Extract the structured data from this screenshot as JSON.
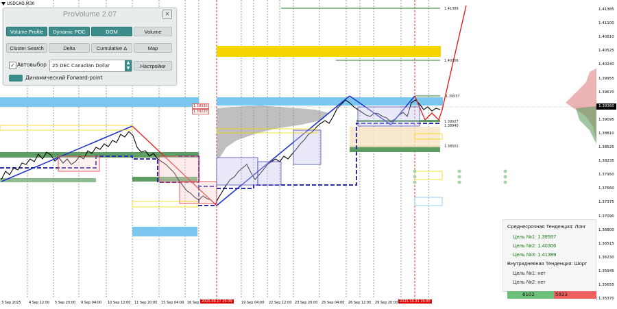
{
  "symbol": "USDCAD,M30",
  "panel": {
    "title": "ProVolume 2.07",
    "close": "×",
    "buttons_row1": [
      "Volume Profile",
      "Dynamic POC",
      "DOM",
      "Volume"
    ],
    "buttons_row2": [
      "Cluster Search",
      "Delta",
      "Cumulative Δ",
      "Map"
    ],
    "auto_label": "Автовыбор",
    "auto_checked": "✓",
    "instrument": "25 DEC Canadian Dollar",
    "settings_button": "Настройки",
    "forward_label": "Динамический Forward-point"
  },
  "y_axis": [
    "1.41385",
    "1.41100",
    "1.40810",
    "1.40525",
    "1.40240",
    "1.39955",
    "1.39670",
    "1.39380",
    "1.39095",
    "1.38810",
    "1.38525",
    "1.38235",
    "1.37950",
    "1.37660",
    "1.37375",
    "1.37090",
    "1.36800",
    "1.36515",
    "1.36230",
    "1.35945",
    "1.35655",
    "1.35370"
  ],
  "current_price": "1.39360",
  "x_axis": [
    "3 Sep 2025",
    "4 Sep 12:00",
    "5 Sep 20:00",
    "9 Sep 04:00",
    "10 Sep 12:00",
    "11 Sep 20:00",
    "15 Sep 04:00",
    "16 Sep",
    "19 Sep 04:00",
    "22 Sep 12:00",
    "23 Sep 20:00",
    "25 Sep 04:00",
    "26 Sep 12:00",
    "29 Sep 20:00"
  ],
  "x_highlight_1": "2025.09.17 20:30",
  "x_highlight_2": "2025.10.01 19:00",
  "levels": {
    "l1": "1.41389",
    "l2": "1.40306",
    "l3": "1.39557",
    "l4": "1.39027",
    "l5": "1.38940",
    "l6": "1.38501",
    "r1": "1.39330",
    "r2": "1.39220"
  },
  "info": {
    "mid_trend": "Среднесрочная Тенденция: Лонг",
    "targets_long": [
      "Цель №1: 1.39557",
      "Цель №2: 1.40306",
      "Цель №3: 1.41389"
    ],
    "intraday_trend": "Внутридневная Тенденция: Шорт",
    "targets_short": [
      "Цель №1: нет",
      "Цель №2: нет"
    ]
  },
  "volume_bar": {
    "buy": "6102",
    "sell": "5923"
  },
  "colors": {
    "accent": "#3b8c8b",
    "trend_up": "#1f33c8",
    "trend_down": "#e02020",
    "zone_blue": "#7cc7ef",
    "zone_yellow": "#f5d500",
    "zone_green": "#5f9e63",
    "profile": "#8b8b8b"
  }
}
